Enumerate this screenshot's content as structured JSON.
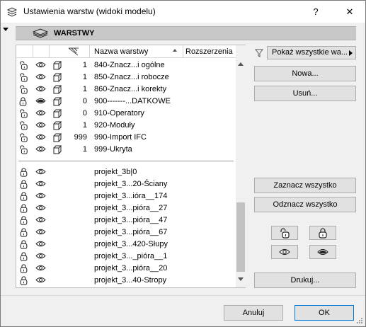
{
  "window": {
    "title": "Ustawienia warstw (widoki modelu)",
    "help_label": "?",
    "close_label": "✕"
  },
  "section": {
    "title": "WARSTWY"
  },
  "list": {
    "columns": {
      "name": "Nazwa warstwy",
      "extension": "Rozszerzenia"
    },
    "layers": [
      {
        "number": "1",
        "name": "840-Znacz...i ogólne",
        "lock": "unlocked",
        "visibility": "eye"
      },
      {
        "number": "1",
        "name": "850-Znacz...i robocze",
        "lock": "unlocked",
        "visibility": "eye"
      },
      {
        "number": "1",
        "name": "860-Znacz...i korekty",
        "lock": "unlocked",
        "visibility": "eye"
      },
      {
        "number": "0",
        "name": "900-------...DATKOWE",
        "lock": "locked",
        "visibility": "hidden"
      },
      {
        "number": "0",
        "name": "910-Operatory",
        "lock": "unlocked",
        "visibility": "eye"
      },
      {
        "number": "1",
        "name": "920-Moduły",
        "lock": "unlocked",
        "visibility": "eye"
      },
      {
        "number": "999",
        "name": "990-Import IFC",
        "lock": "unlocked",
        "visibility": "eye"
      },
      {
        "number": "1",
        "name": "999-Ukryta",
        "lock": "unlocked",
        "visibility": "eye"
      }
    ],
    "xref_layers": [
      {
        "name": "projekt_3b|0"
      },
      {
        "name": "projekt_3...20-Ściany"
      },
      {
        "name": "projekt_3...ióra__174"
      },
      {
        "name": "projekt_3...pióra__27"
      },
      {
        "name": "projekt_3...pióra__47"
      },
      {
        "name": "projekt_3...pióra__67"
      },
      {
        "name": "projekt_3...420-Słupy"
      },
      {
        "name": "projekt_3..._pióra__1"
      },
      {
        "name": "projekt_3...pióra__20"
      },
      {
        "name": "projekt_3...40-Stropy"
      }
    ]
  },
  "filter": {
    "label": "Pokaż wszystkie wa..."
  },
  "buttons": {
    "new": "Nowa...",
    "delete": "Usuń...",
    "select_all": "Zaznacz wszystko",
    "deselect_all": "Odznacz wszystko",
    "print": "Drukuj...",
    "cancel": "Anuluj",
    "ok": "OK"
  },
  "icons": {
    "unlocked": "unlocked-padlock-icon",
    "locked": "padlock-icon",
    "eye": "eye-icon",
    "hidden": "closed-eye-icon",
    "layer": "layer-stack-icon",
    "filter": "funnel-icon"
  }
}
